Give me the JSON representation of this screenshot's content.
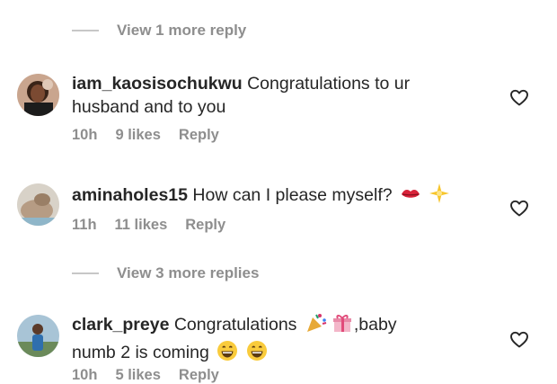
{
  "thread1": {
    "view_more_label": "View 1 more reply"
  },
  "comments": [
    {
      "username": "iam_kaosisochukwu",
      "text_line1": "Congratulations to ur",
      "text_line2": "husband and to you",
      "time": "10h",
      "likes": "9 likes",
      "reply_label": "Reply"
    },
    {
      "username": "aminaholes15",
      "text": "How can I please myself?",
      "time": "11h",
      "likes": "11 likes",
      "reply_label": "Reply",
      "emojis": [
        "kiss-mark-icon",
        "sparkle-star-icon"
      ]
    },
    {
      "username": "clark_preye",
      "text_line1": "Congratulations",
      "text_line1_tail": ",baby",
      "text_line2": "numb 2 is coming",
      "time": "10h",
      "likes": "5 likes",
      "reply_label": "Reply",
      "emojis": [
        "party-popper-icon",
        "gift-icon",
        "grinning-face-icon",
        "grinning-face-icon"
      ]
    }
  ],
  "thread2": {
    "view_more_label": "View 3 more replies"
  },
  "colors": {
    "text": "#262626",
    "secondary": "#8e8e8e",
    "divider": "#c7c7c7"
  }
}
